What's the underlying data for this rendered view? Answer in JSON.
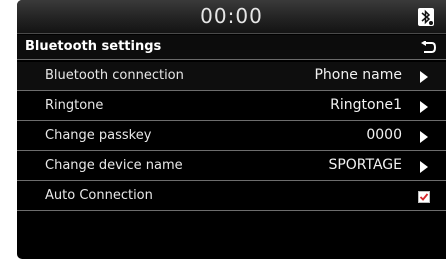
{
  "status_bar": {
    "time": "00:00",
    "bluetooth_icon": "bluetooth-phone-icon"
  },
  "header": {
    "title": "Bluetooth settings",
    "back_icon": "back-arrow-icon"
  },
  "settings": {
    "items": [
      {
        "label": "Bluetooth connection",
        "value": "Phone name"
      },
      {
        "label": "Ringtone",
        "value": "Ringtone1"
      },
      {
        "label": "Change passkey",
        "value": "0000"
      },
      {
        "label": "Change device name",
        "value": "SPORTAGE"
      },
      {
        "label": "Auto Connection",
        "checked": true
      }
    ]
  },
  "colors": {
    "background": "#000000",
    "text": "#f2f2f2",
    "divider": "#6d6d6d",
    "checkbox_check": "#d6282c"
  }
}
